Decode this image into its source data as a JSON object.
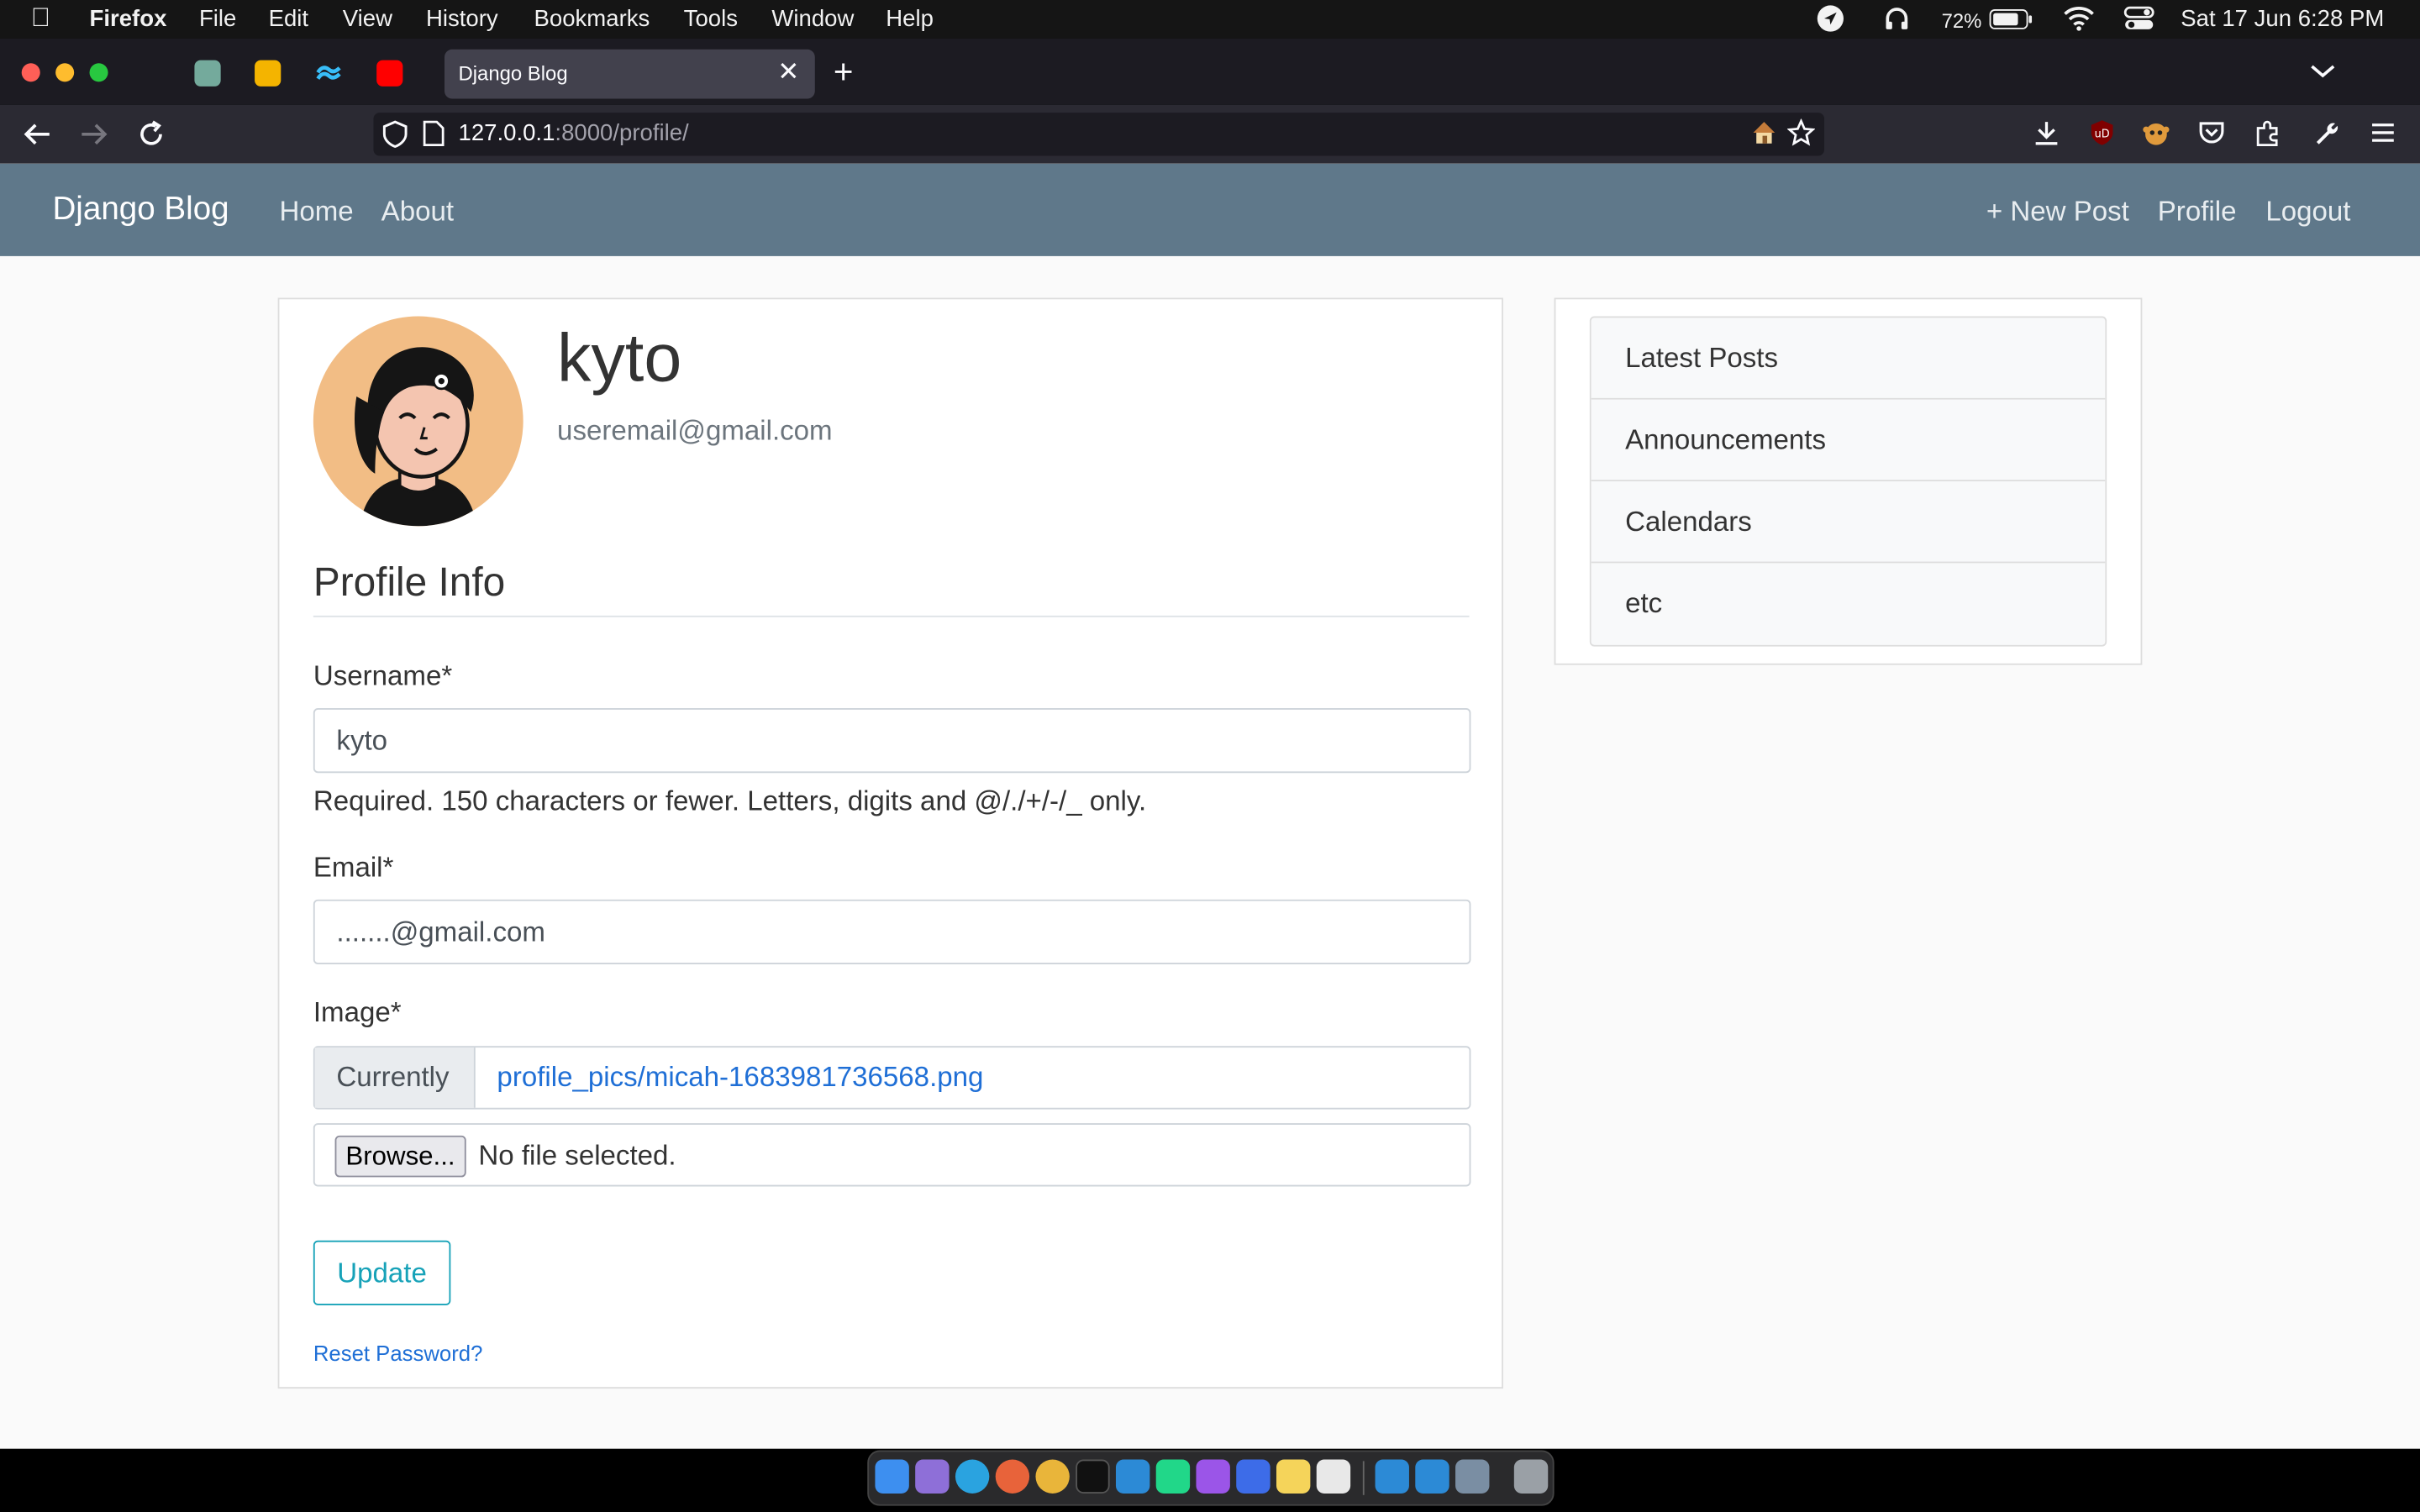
{
  "menubar": {
    "app_name": "Firefox",
    "menus": [
      "File",
      "Edit",
      "View",
      "History",
      "Bookmarks",
      "Tools",
      "Window",
      "Help"
    ],
    "battery": "72%",
    "clock": "Sat 17 Jun  6:28 PM"
  },
  "browser": {
    "tab_title": "Django Blog",
    "url_host": "127.0.0.1",
    "url_rest": ":8000/profile/"
  },
  "site": {
    "brand": "Django Blog",
    "nav_left": [
      "Home",
      "About"
    ],
    "nav_right": [
      "+ New Post",
      "Profile",
      "Logout"
    ]
  },
  "profile": {
    "username": "kyto",
    "email": "useremail@gmail.com",
    "section_title": "Profile Info",
    "form": {
      "username_label": "Username*",
      "username_value": "kyto",
      "username_help": "Required. 150 characters or fewer. Letters, digits and @/./+/-/_ only.",
      "email_label": "Email*",
      "email_value": ".......@gmail.com",
      "image_label": "Image*",
      "currently_label": "Currently",
      "current_file": "profile_pics/micah-1683981736568.png",
      "browse_label": "Browse...",
      "no_file_text": "No file selected.",
      "update_label": "Update",
      "reset_link": "Reset Password?"
    }
  },
  "sidebar": {
    "items": [
      "Latest Posts",
      "Announcements",
      "Calendars",
      "etc"
    ]
  },
  "colors": {
    "navbar": "#5f788a",
    "accent_info": "#17a2b8",
    "link": "#1f6fd6",
    "avatar_bg": "#f2bd85"
  }
}
